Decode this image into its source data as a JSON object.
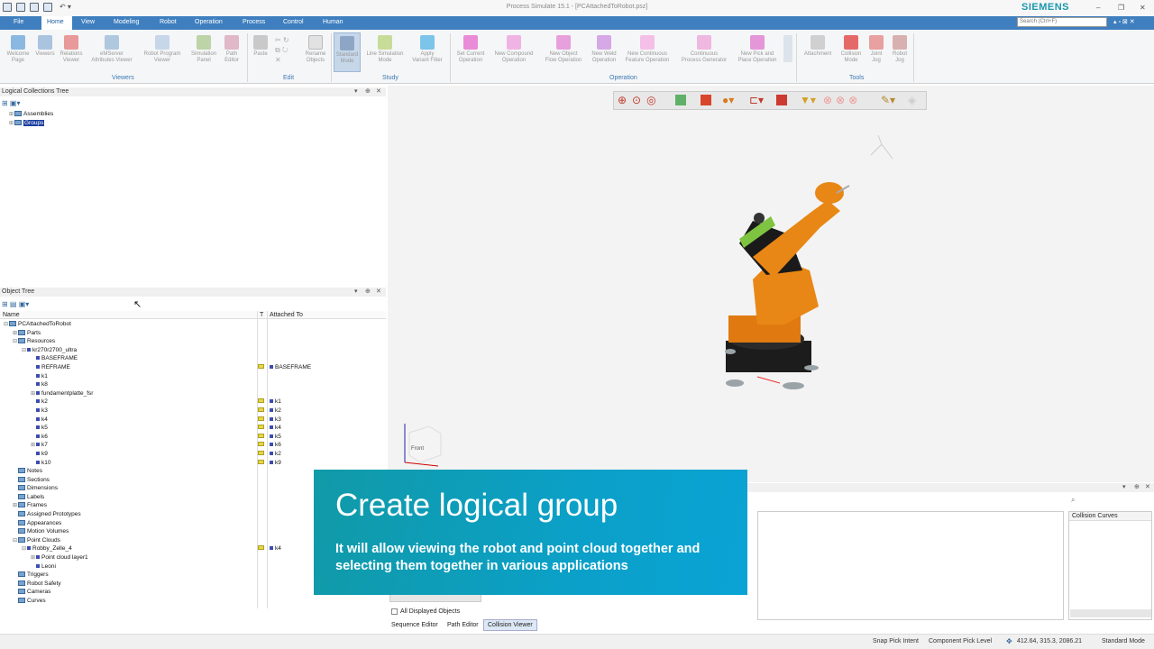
{
  "window": {
    "title": "Process Simulate 15.1 - [PCAttachedToRobot.psz]",
    "brand": "SIEMENS",
    "search_placeholder": "Search (Ctrl+F)"
  },
  "menu": [
    "File",
    "Home",
    "View",
    "Modeling",
    "Robot",
    "Operation",
    "Process",
    "Control",
    "Human"
  ],
  "ribbon": {
    "buttons": [
      {
        "label": "Welcome\nPage"
      },
      {
        "label": "Viewers"
      },
      {
        "label": "Relations\nViewer"
      },
      {
        "label": "eMServer\nAttributes Viewer"
      },
      {
        "label": "Robot Program\nViewer"
      },
      {
        "label": "Simulation\nPanel"
      },
      {
        "label": "Path\nEditor"
      },
      {
        "label": "Paste"
      },
      {
        "label": "Rename\nObjects"
      },
      {
        "label": "Standard\nMode"
      },
      {
        "label": "Line Simulation\nMode"
      },
      {
        "label": "Apply\nVariant Filter"
      },
      {
        "label": "Set Current\nOperation"
      },
      {
        "label": "New Compound\nOperation"
      },
      {
        "label": "New Object\nFlow Operation"
      },
      {
        "label": "New Weld\nOperation"
      },
      {
        "label": "New Continuous\nFeature Operation"
      },
      {
        "label": "Continuous\nProcess Generator"
      },
      {
        "label": "New Pick and\nPlace Operation"
      },
      {
        "label": "Attachment"
      },
      {
        "label": "Collision\nMode"
      },
      {
        "label": "Joint\nJog"
      },
      {
        "label": "Robot\nJog"
      }
    ],
    "groups": [
      "Viewers",
      "Edit",
      "Study",
      "Operation",
      "Tools"
    ]
  },
  "logical_tree": {
    "title": "Logical Collections Tree",
    "items": [
      "Assemblies",
      "Groups"
    ]
  },
  "object_tree": {
    "title": "Object Tree",
    "columns": [
      "Name",
      "T",
      "Attached To"
    ],
    "rows": [
      {
        "name": "PCAttachedToRobot",
        "attached": ""
      },
      {
        "name": "Parts",
        "attached": ""
      },
      {
        "name": "Resources",
        "attached": ""
      },
      {
        "name": "kr270r2700_ultra",
        "attached": ""
      },
      {
        "name": "BASEFRAME",
        "attached": ""
      },
      {
        "name": "REFRAME",
        "attached": "BASEFRAME"
      },
      {
        "name": "k1",
        "attached": ""
      },
      {
        "name": "k8",
        "attached": ""
      },
      {
        "name": "fundamentplatte_fsr",
        "attached": ""
      },
      {
        "name": "k2",
        "attached": "k1"
      },
      {
        "name": "k3",
        "attached": "k2"
      },
      {
        "name": "k4",
        "attached": "k3"
      },
      {
        "name": "k5",
        "attached": "k4"
      },
      {
        "name": "k6",
        "attached": "k5"
      },
      {
        "name": "k7",
        "attached": "k6"
      },
      {
        "name": "k9",
        "attached": "k2"
      },
      {
        "name": "k10",
        "attached": "k9"
      },
      {
        "name": "Notes",
        "attached": ""
      },
      {
        "name": "Sections",
        "attached": ""
      },
      {
        "name": "Dimensions",
        "attached": ""
      },
      {
        "name": "Labels",
        "attached": ""
      },
      {
        "name": "Frames",
        "attached": ""
      },
      {
        "name": "Assigned Prototypes",
        "attached": ""
      },
      {
        "name": "Appearances",
        "attached": ""
      },
      {
        "name": "Motion Volumes",
        "attached": ""
      },
      {
        "name": "Point Clouds",
        "attached": ""
      },
      {
        "name": "Robby_Zelle_4",
        "attached": "k4"
      },
      {
        "name": "Point cloud layer1",
        "attached": ""
      },
      {
        "name": "Leoni",
        "attached": ""
      },
      {
        "name": "Triggers",
        "attached": ""
      },
      {
        "name": "Robot Safety",
        "attached": ""
      },
      {
        "name": "Cameras",
        "attached": ""
      },
      {
        "name": "Curves",
        "attached": ""
      }
    ]
  },
  "banner": {
    "title": "Create logical group",
    "subtitle": "It will allow viewing the robot and point cloud together and selecting them together in various applications"
  },
  "bottom": {
    "checkbox_label": "All Displayed Objects",
    "tabs": [
      "Sequence Editor",
      "Path Editor",
      "Collision Viewer"
    ],
    "collision_curves": "Collision Curves"
  },
  "status": {
    "snap": "Snap Pick Intent",
    "pick": "Component Pick Level",
    "coords": "412.64, 315.3, 2086.21",
    "mode": "Standard Mode"
  },
  "cube_label": "Front"
}
